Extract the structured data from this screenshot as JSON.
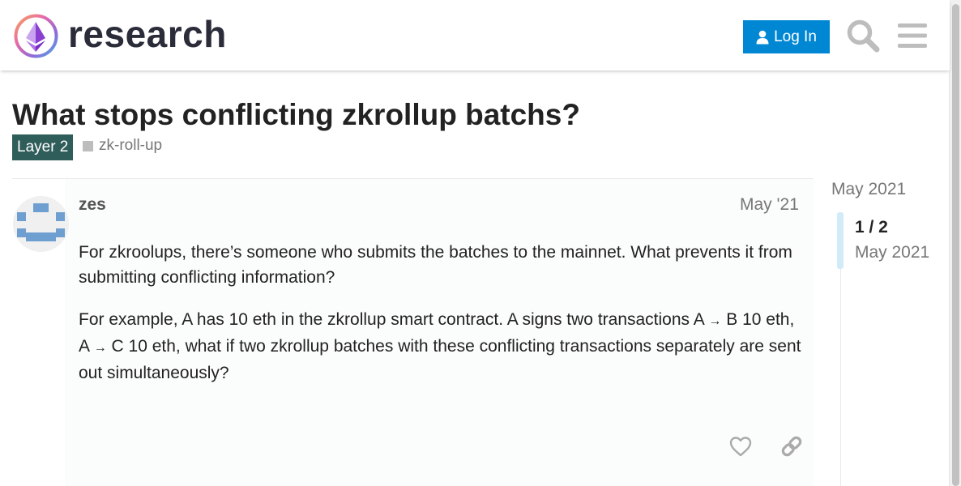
{
  "header": {
    "site_name": "research",
    "login_label": "Log In",
    "icons": [
      "logo-icon",
      "user-icon",
      "search-icon",
      "hamburger-menu-icon"
    ]
  },
  "topic": {
    "title": "What stops conflicting zkrollup batchs?",
    "category": "Layer 2",
    "category_color": "#2f5d5a",
    "tag": "zk-roll-up"
  },
  "post": {
    "username": "zes",
    "date": "May '21",
    "para1": "For zkroolups, there’s someone who submits the batches to the mainnet. What prevents it from submitting conflicting information?",
    "para2": {
      "t1": "For example, A has 10 eth in the zkrollup smart contract. A signs two transactions A ",
      "arrow": "→",
      "t2": " B 10 eth, A ",
      "t3": " C 10 eth, what if two zkrollup batches with these conflicting transactions separately are sent out simultaneously?"
    },
    "actions": [
      "heart-icon",
      "link-icon"
    ]
  },
  "timeline": {
    "start_date": "May 2021",
    "count": "1 / 2",
    "current_date": "May 2021"
  },
  "colors": {
    "accent": "#0087d4",
    "text": "#222222",
    "muted": "#777777"
  }
}
